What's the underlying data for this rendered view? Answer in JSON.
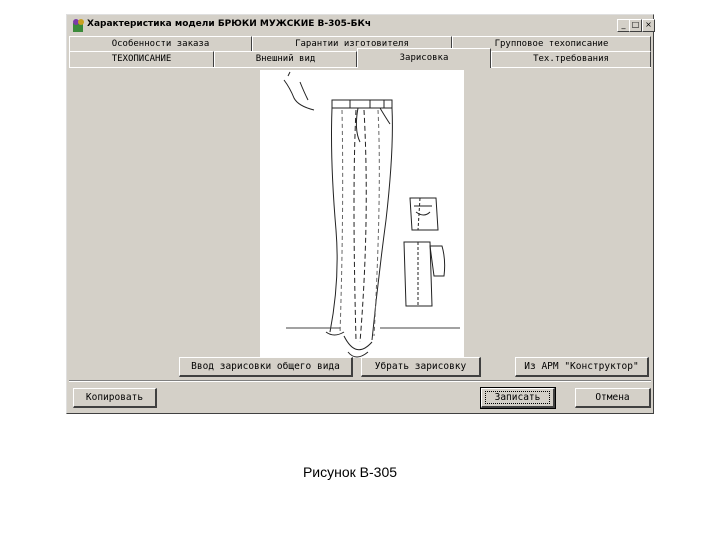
{
  "window": {
    "title": "Характеристика модели БРЮКИ МУЖСКИЕ В-305-БКч",
    "minimize_glyph": "_",
    "maximize_glyph": "□",
    "close_glyph": "×"
  },
  "tabs_top": [
    {
      "label": "Особенности заказа"
    },
    {
      "label": "Гарантии изготовителя"
    },
    {
      "label": "Групповое техописание"
    }
  ],
  "tabs_bottom": [
    {
      "label": "ТЕХОПИСАНИЕ"
    },
    {
      "label": "Внешний вид"
    },
    {
      "label": "Зарисовка",
      "active": true
    },
    {
      "label": "Тех.требования"
    }
  ],
  "panel_buttons": {
    "input_sketch": "Ввод зарисовки общего вида",
    "remove_sketch": "Убрать зарисовку",
    "from_arm": "Из АРМ \"Конструктор\""
  },
  "footer_buttons": {
    "copy": "Копировать",
    "save": "Записать",
    "cancel": "Отмена"
  },
  "caption": "Рисунок В-305",
  "colors": {
    "window_bg": "#d4d0c8",
    "sketch_bg": "#ffffff"
  },
  "icons": {
    "app": "app-icon",
    "sketch": "trousers-sketch"
  }
}
